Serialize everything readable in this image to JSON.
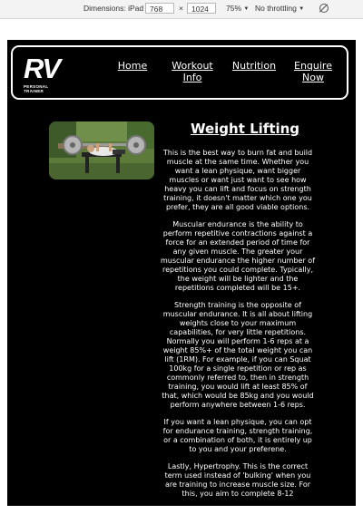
{
  "devtools": {
    "dimensions_label": "Dimensions: iPad Mini",
    "width": "768",
    "times": "×",
    "height": "1024",
    "zoom": "75%",
    "throttle": "No throttling",
    "rotate_icon": "rotate-icon"
  },
  "site": {
    "logo_text": "RV",
    "logo_subtext": "PERSONAL TRAINER",
    "nav": [
      {
        "label": "Home"
      },
      {
        "label": "Workout Info"
      },
      {
        "label": "Nutrition"
      },
      {
        "label": "Enquire Now"
      }
    ]
  },
  "main": {
    "title": "Weight Lifting",
    "paragraphs": [
      "This is the best way to burn fat and build muscle at the same time. Whether you want a lean physique, want bigger muscles or want just want to see how heavy you can lift and focus on strength training, it doesn't matter which one you prefer, they are all good viable options.",
      "Muscular endurance is the ability to perform repetitive contractions against a force for an extended period of time for any given muscle. The greater your muscular endurance the higher number of repetitions you could complete. Typically, the weight will be lighter and the repetitions completed will be 15+.",
      "Strength training is the opposite of muscular endurance. It is all about lifting weights close to your maximum capabilities, for very little repetitions. Normally you will perform 1-6 reps at a weight 85%+ of the total weight you can lift (1RM). For example, if you can Squat 100kg for a single repetition or rep as commonly referred to, then in strength training, you would lift at least 85% of that, which would be 85kg and you would perform anywhere between 1-6 reps.",
      "If you want a lean physique, you can opt for endurance training, strength training, or a combination of both, it is entirely up to you and your preferene.",
      "Lastly, Hypertrophy. This is the correct term used instead of 'bulking' when you are training to increase muscle size. For this, you aim to complete 8-12"
    ]
  }
}
